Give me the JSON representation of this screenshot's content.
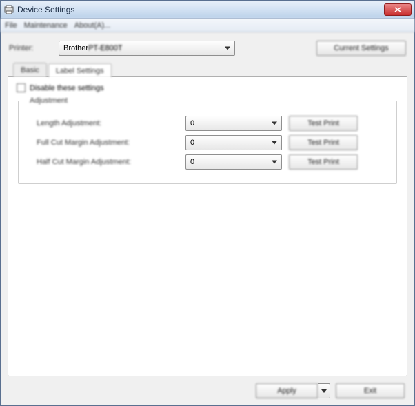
{
  "window": {
    "title": "Device Settings"
  },
  "menubar": {
    "file": "File",
    "maintenance": "Maintenance",
    "about": "About(A)..."
  },
  "top": {
    "printer_label": "Printer:",
    "printer_value_prefix": "Brother ",
    "printer_value_model": "PT-E800T",
    "current_settings": "Current Settings"
  },
  "tabs": {
    "basic": "Basic",
    "label_settings": "Label Settings"
  },
  "panel": {
    "disable_label": "Disable these settings",
    "group_legend": "Adjustment",
    "rows": [
      {
        "label": "Length Adjustment:",
        "value": "0",
        "test": "Test Print"
      },
      {
        "label": "Full Cut Margin Adjustment:",
        "value": "0",
        "test": "Test Print"
      },
      {
        "label": "Half Cut Margin Adjustment:",
        "value": "0",
        "test": "Test Print"
      }
    ]
  },
  "bottom": {
    "apply": "Apply",
    "exit": "Exit"
  }
}
